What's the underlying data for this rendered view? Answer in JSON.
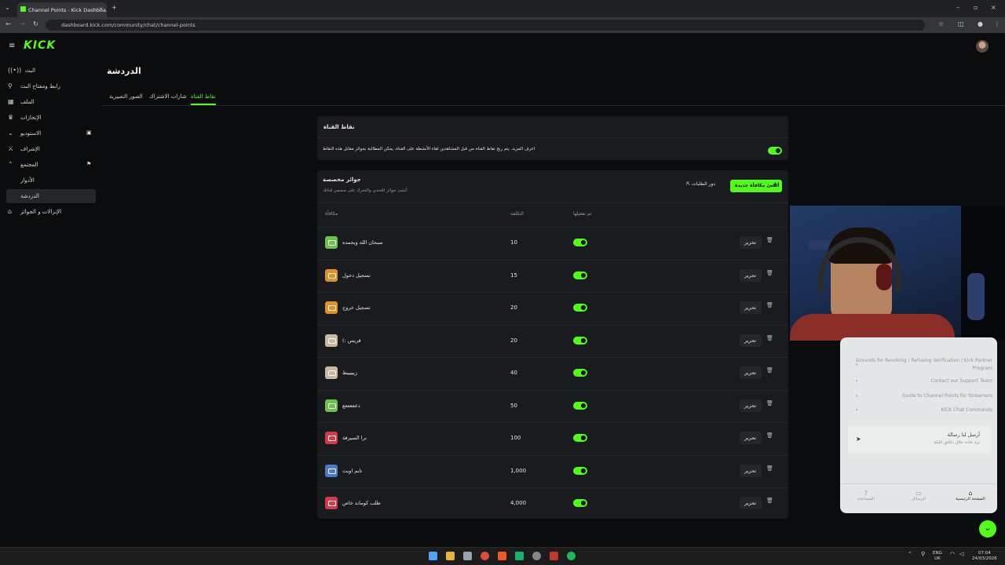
{
  "browser": {
    "tab_title": "Channel Points - Kick Dashboa…",
    "url": "dashboard.kick.com/community/chat/channel-points"
  },
  "app": {
    "logo": "KICK"
  },
  "sidebar": {
    "items": [
      {
        "label": "البث",
        "icon": "broadcast-icon"
      },
      {
        "label": "رابط ومفتاح البث",
        "icon": "link-icon"
      },
      {
        "label": "الملف",
        "icon": "file-icon"
      },
      {
        "label": "الإنجازات",
        "icon": "trophy-icon"
      },
      {
        "label": "الاستوديو",
        "icon": "chevron-down-icon"
      },
      {
        "label": "الإشراف",
        "icon": "sword-icon"
      },
      {
        "label": "المجتمع",
        "icon": "chevron-up-icon"
      },
      {
        "label": "الأدوار",
        "icon": ""
      },
      {
        "label": "الدردشة",
        "icon": ""
      },
      {
        "label": "الإنزالات و الجوائز",
        "icon": "gift-icon"
      }
    ]
  },
  "page": {
    "title": "الدردشة",
    "tabs": [
      "نقاط القناة",
      "شارات الاشتراك",
      "الصور التعبيرية"
    ]
  },
  "channel_points": {
    "heading": "نقاط القناة",
    "description": "اعرف المزيد. يتم ربح نقاط القناة من قبل المشاهدين لقاء الأنشطة على القناة. يمكن المطالبة بجوائز مقابل هذه النقاط",
    "enabled": true
  },
  "rewards": {
    "heading": "جوائز مخصصة",
    "subheading": "أنشئ جوائز للتحدي والتحرك على منجمي قناتك",
    "create_label": "أنشئ مكافأة جديدة",
    "queue_label": "دور الطلبات",
    "columns": {
      "reward": "مكافأة",
      "cost": "التكلفة",
      "enabled": "تم تفعيلها"
    },
    "edit_label": "تحرير",
    "rows": [
      {
        "name": "سبحان الله وبحمده",
        "cost": "10",
        "color": "#6bc24a"
      },
      {
        "name": "تسجيل دخول",
        "cost": "15",
        "color": "#e0902a"
      },
      {
        "name": "تسجيل خروج",
        "cost": "20",
        "color": "#e0902a"
      },
      {
        "name": "(: قريس",
        "cost": "20",
        "color": "#c8b8a0"
      },
      {
        "name": "زيييييط",
        "cost": "40",
        "color": "#c8b8a0"
      },
      {
        "name": "دعععععع",
        "cost": "50",
        "color": "#6bc24a"
      },
      {
        "name": "برا السيرفة",
        "cost": "100",
        "color": "#d23a4a"
      },
      {
        "name": "تايم اويت",
        "cost": "1,000",
        "color": "#4a7ac8"
      },
      {
        "name": "طلب كوماند خاص",
        "cost": "4,000",
        "color": "#d23a4a"
      }
    ]
  },
  "help": {
    "links": [
      "Grounds for Revoking / Refusing Verification / Kick Partner Program",
      "Contact our Support Team",
      "Guide to Channel Points for Streamers",
      "KICK Chat Commands"
    ],
    "message_title": "أرسل لنا رسالة",
    "message_sub": "نرد عادة خلال دقائق قليلة",
    "nav": [
      "المساعدة",
      "الرسائل",
      "الصفحة الرئيسية"
    ]
  },
  "taskbar": {
    "lang": "ENG",
    "region": "UK",
    "time": "07:04",
    "date": "24/03/2026"
  }
}
